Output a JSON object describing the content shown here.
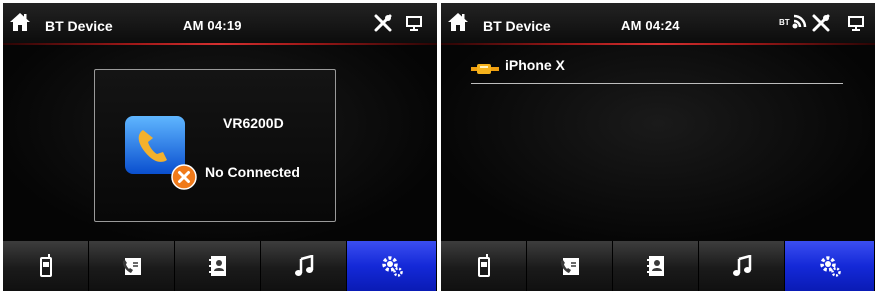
{
  "screens": [
    {
      "title": "BT Device",
      "time": "AM 04:19",
      "dialog": {
        "device_name": "VR6200D",
        "status": "No Connected"
      },
      "tabs": [
        "phone",
        "call-log",
        "contacts",
        "music",
        "settings"
      ],
      "active_tab": "settings"
    },
    {
      "title": "BT Device",
      "time": "AM 04:24",
      "bt_indicator": "BT",
      "device_list": [
        "iPhone X"
      ],
      "tabs": [
        "phone",
        "call-log",
        "contacts",
        "music",
        "settings"
      ],
      "active_tab": "settings"
    }
  ],
  "colors": {
    "accent_line": "#c82828",
    "active_tab": "#1a2fe0",
    "background": "#000000"
  }
}
